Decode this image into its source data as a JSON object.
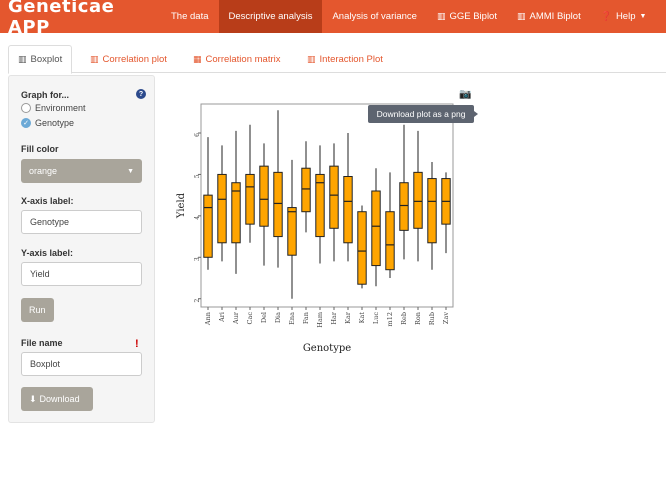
{
  "navbar": {
    "brand": "Geneticae APP",
    "items": [
      {
        "label": "The data",
        "icon": "",
        "active": false
      },
      {
        "label": "Descriptive analysis",
        "icon": "",
        "active": true
      },
      {
        "label": "Analysis of variance",
        "icon": "",
        "active": false
      },
      {
        "label": "GGE Biplot",
        "icon": "bar-chart-icon",
        "active": false
      },
      {
        "label": "AMMI Biplot",
        "icon": "bar-chart-icon",
        "active": false
      },
      {
        "label": "Help",
        "icon": "question-circle-icon",
        "active": false
      }
    ]
  },
  "tabs": [
    {
      "label": "Boxplot",
      "icon": "bar-chart-icon",
      "active": true
    },
    {
      "label": "Correlation plot",
      "icon": "bar-chart-icon",
      "active": false
    },
    {
      "label": "Correlation matrix",
      "icon": "table-icon",
      "active": false
    },
    {
      "label": "Interaction Plot",
      "icon": "bar-chart-icon",
      "active": false
    }
  ],
  "sidebar": {
    "graph_for_label": "Graph for...",
    "options": [
      {
        "label": "Environment",
        "checked": false
      },
      {
        "label": "Genotype",
        "checked": true
      }
    ],
    "fill_color_label": "Fill color",
    "fill_color_value": "orange",
    "xaxis_label": "X-axis label:",
    "xaxis_value": "Genotype",
    "yaxis_label": "Y-axis label:",
    "yaxis_value": "Yield",
    "run_label": "Run",
    "file_name_label": "File name",
    "file_name_value": "Boxplot",
    "warning_mark": "!",
    "download_label": "Download"
  },
  "plot": {
    "tooltip": "Download plot as a png"
  },
  "colors": {
    "navbar": "#e4572e",
    "navbar_active": "#b83d19",
    "box_fill": "#ffa500",
    "button": "#a9a59b"
  },
  "chart_data": {
    "type": "boxplot",
    "xlabel": "Genotype",
    "ylabel": "Yield",
    "ylim": [
      1.8,
      6.7
    ],
    "yticks": [
      "2",
      "3",
      "4",
      "5",
      "6"
    ],
    "categories": [
      "Ann",
      "Ari",
      "Aur",
      "Cac",
      "Del",
      "Dia",
      "Ena",
      "Fan",
      "Ham",
      "Har",
      "Kar",
      "Kat",
      "Luc",
      "m12",
      "Reb",
      "Ron",
      "Rub",
      "Zav"
    ],
    "boxes": [
      {
        "min": 2.7,
        "q1": 3.0,
        "median": 4.2,
        "q3": 4.5,
        "max": 5.9
      },
      {
        "min": 2.9,
        "q1": 3.35,
        "median": 4.4,
        "q3": 5.0,
        "max": 5.7
      },
      {
        "min": 2.6,
        "q1": 3.35,
        "median": 4.6,
        "q3": 4.8,
        "max": 6.05
      },
      {
        "min": 3.35,
        "q1": 3.8,
        "median": 4.7,
        "q3": 5.0,
        "max": 6.2
      },
      {
        "min": 2.8,
        "q1": 3.75,
        "median": 4.4,
        "q3": 5.2,
        "max": 5.75
      },
      {
        "min": 2.75,
        "q1": 3.5,
        "median": 4.3,
        "q3": 5.05,
        "max": 6.55
      },
      {
        "min": 2.0,
        "q1": 3.05,
        "median": 4.1,
        "q3": 4.2,
        "max": 5.35
      },
      {
        "min": 3.6,
        "q1": 4.1,
        "median": 4.65,
        "q3": 5.15,
        "max": 5.8
      },
      {
        "min": 2.85,
        "q1": 3.5,
        "median": 4.8,
        "q3": 5.0,
        "max": 5.7
      },
      {
        "min": 2.9,
        "q1": 3.7,
        "median": 4.5,
        "q3": 5.2,
        "max": 5.75
      },
      {
        "min": 2.9,
        "q1": 3.35,
        "median": 4.35,
        "q3": 4.95,
        "max": 6.0
      },
      {
        "min": 2.25,
        "q1": 2.35,
        "median": 3.15,
        "q3": 4.1,
        "max": 4.25
      },
      {
        "min": 2.3,
        "q1": 2.8,
        "median": 3.75,
        "q3": 4.6,
        "max": 5.15
      },
      {
        "min": 2.5,
        "q1": 2.7,
        "median": 3.3,
        "q3": 4.1,
        "max": 5.05
      },
      {
        "min": 2.95,
        "q1": 3.65,
        "median": 4.25,
        "q3": 4.8,
        "max": 6.2
      },
      {
        "min": 2.9,
        "q1": 3.7,
        "median": 4.35,
        "q3": 5.05,
        "max": 6.05
      },
      {
        "min": 2.7,
        "q1": 3.35,
        "median": 4.35,
        "q3": 4.9,
        "max": 5.3
      },
      {
        "min": 3.1,
        "q1": 3.8,
        "median": 4.35,
        "q3": 4.9,
        "max": 5.05
      }
    ]
  }
}
